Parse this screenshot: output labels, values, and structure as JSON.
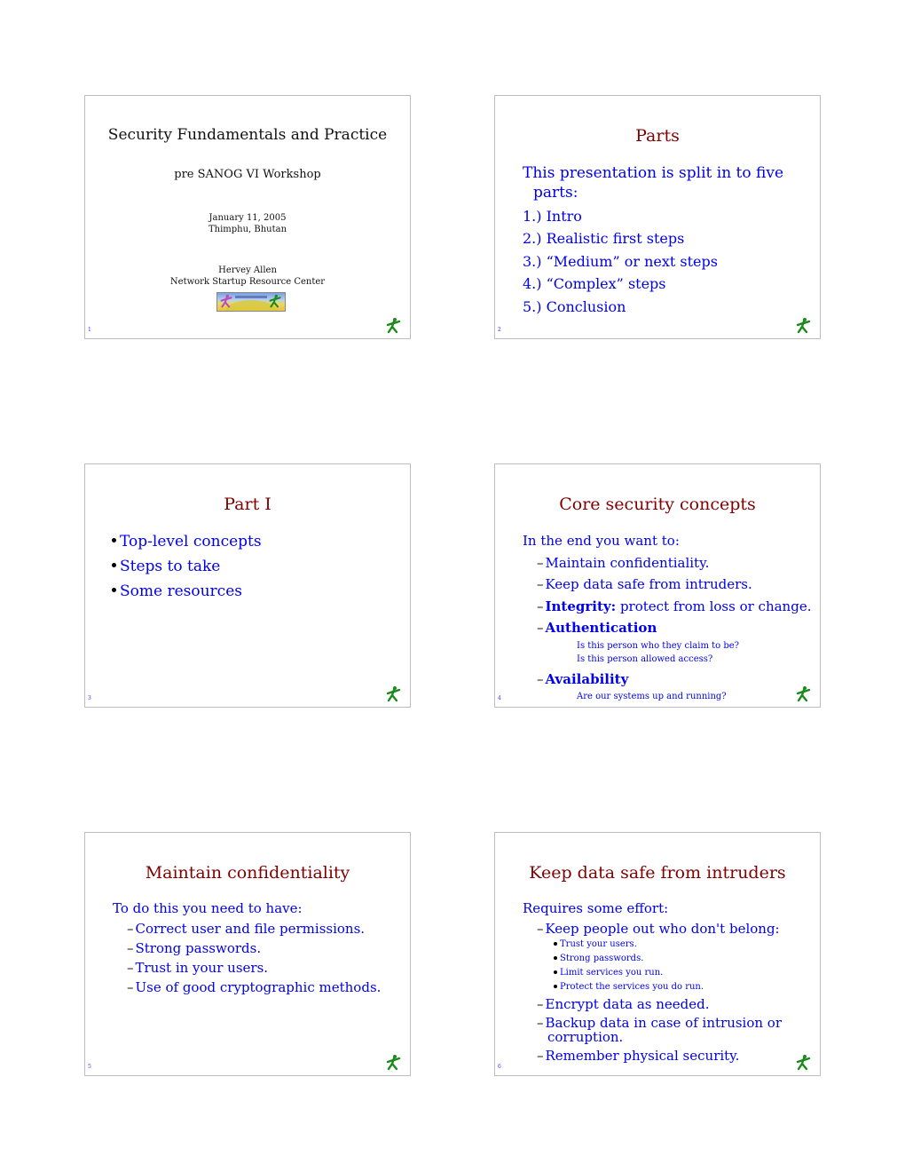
{
  "slides": [
    {
      "number": "1",
      "title": "Security Fundamentals and Practice",
      "subtitle": "pre SANOG VI Workshop",
      "date": "January 11, 2005",
      "location": "Thimphu, Bhutan",
      "author": "Hervey Allen",
      "organization": "Network Startup Resource Center",
      "logo_image": "nsrc-globe-logo"
    },
    {
      "number": "2",
      "title": "Parts",
      "intro_line1": "This presentation is split in to five",
      "intro_line2": "parts:",
      "items": [
        "1.) Intro",
        "2.) Realistic first steps",
        "3.) “Medium” or next steps",
        "4.) “Complex” steps",
        "5.) Conclusion"
      ]
    },
    {
      "number": "3",
      "title": "Part I",
      "bullets": [
        "Top-level concepts",
        "Steps to take",
        "Some resources"
      ]
    },
    {
      "number": "4",
      "title": "Core security concepts",
      "intro": "In the end you want to:",
      "items": [
        {
          "text": "Maintain confidentiality."
        },
        {
          "text": "Keep data safe from intruders."
        },
        {
          "bold": "Integrity:",
          "text": " protect from loss or change."
        },
        {
          "bold": "Authentication",
          "sub": [
            "Is this person who they claim to be?",
            "Is this person allowed access?"
          ]
        },
        {
          "bold": "Availability",
          "sub": [
            "Are our systems up and running?"
          ]
        }
      ]
    },
    {
      "number": "5",
      "title": "Maintain confidentiality",
      "intro": "To do this you need to have:",
      "items": [
        "Correct user and file permissions.",
        "Strong passwords.",
        "Trust in your users.",
        "Use of good cryptographic methods."
      ]
    },
    {
      "number": "6",
      "title": "Keep data safe from intruders",
      "intro": "Requires some effort:",
      "item1": "Keep people out who don't belong:",
      "subitems": [
        "Trust your users.",
        "Strong passwords.",
        "Limit services you run.",
        "Protect the services you do run."
      ],
      "item2": "Encrypt data as needed.",
      "item3_line1": "Backup data in case of intrusion or",
      "item3_line2": "corruption.",
      "item4": "Remember physical security."
    }
  ],
  "colors": {
    "title": "#800000",
    "body": "#0000ee",
    "logo": "#1a8a1a"
  }
}
